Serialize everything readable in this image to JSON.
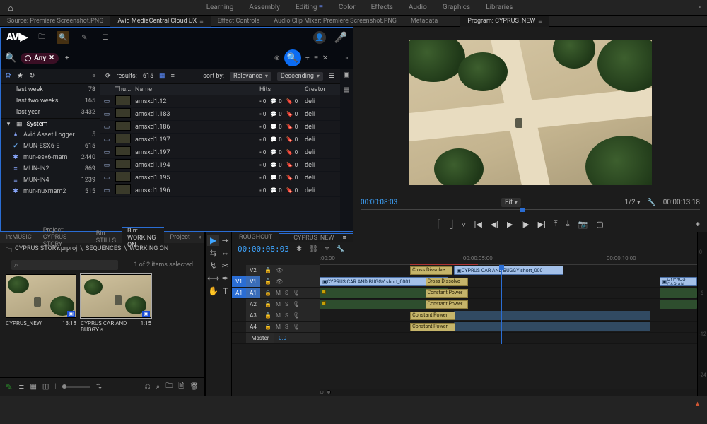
{
  "workspace": {
    "items": [
      "Learning",
      "Assembly",
      "Editing",
      "Color",
      "Effects",
      "Audio",
      "Graphics",
      "Libraries"
    ],
    "active": "Editing"
  },
  "source_tabs": {
    "items": [
      "Source: Premiere Screenshot.PNG",
      "Avid MediaCentral Cloud UX",
      "Effect Controls",
      "Audio Clip Mixer: Premiere Screenshot.PNG",
      "Metadata"
    ],
    "active": 1
  },
  "program_tab": "Program: CYPRUS_NEW",
  "avid": {
    "tag": {
      "label": "Any"
    },
    "results_label": "results:",
    "results_count": "615",
    "sort_label": "sort by:",
    "sort_field": "Relevance",
    "sort_dir": "Descending",
    "side_saved": [
      {
        "label": "last week",
        "count": "78"
      },
      {
        "label": "last two weeks",
        "count": "165"
      },
      {
        "label": "last year",
        "count": "3432"
      }
    ],
    "side_sys_label": "System",
    "side_sys": [
      {
        "ic": "★",
        "label": "Avid Asset Logger",
        "count": "5"
      },
      {
        "ic": "✔",
        "label": "MUN-ESX6-E",
        "count": "615"
      },
      {
        "ic": "✱",
        "label": "mun-esx6-mam",
        "count": "2440"
      },
      {
        "ic": "≡",
        "label": "MUN-IN2",
        "count": "869"
      },
      {
        "ic": "≡",
        "label": "MUN-IN4",
        "count": "1239"
      },
      {
        "ic": "✱",
        "label": "mun-nuxmam2",
        "count": "515"
      }
    ],
    "cols": {
      "thumb": "Thu...",
      "name": "Name",
      "hits": "Hits",
      "creator": "Creator"
    },
    "rows": [
      {
        "name": "amsxd1.12",
        "creator": "deli"
      },
      {
        "name": "amsxd1.183",
        "creator": "deli"
      },
      {
        "name": "amsxd1.186",
        "creator": "deli"
      },
      {
        "name": "amsxd1.197",
        "creator": "deli"
      },
      {
        "name": "amsxd1.197",
        "creator": "deli"
      },
      {
        "name": "amsxd1.194",
        "creator": "deli"
      },
      {
        "name": "amsxd1.195",
        "creator": "deli"
      },
      {
        "name": "amsxd1.196",
        "creator": "deli"
      }
    ],
    "hits_template": {
      "a": "0",
      "b": "0",
      "c": "0"
    }
  },
  "program": {
    "tc_in": "00:00:08:03",
    "fit": "Fit",
    "zoom": "1/2",
    "tc_out": "00:00:13:18"
  },
  "project": {
    "tabs": [
      "in:MUSIC",
      "Project: CYPRUS STORY",
      "Bin: STILLS",
      "Bin: WORKING ON",
      "Project"
    ],
    "active": 3,
    "crumb_parts": [
      "CYPRUS STORY.prproj",
      "SEQUENCES",
      "WORKING ON"
    ],
    "selected_text": "1 of 2 items selected",
    "clips": [
      {
        "name": "CYPRUS_NEW",
        "dur": "13:18"
      },
      {
        "name": "CYPRUS CAR AND BUGGY s...",
        "dur": "1:15"
      }
    ]
  },
  "timeline": {
    "tabs": [
      "ROUGHCUT",
      "CYPRUS_NEW"
    ],
    "active": 1,
    "tc": "00:00:08:03",
    "ruler": [
      {
        "t": ":00:00",
        "p": 0
      },
      {
        "t": "00:00:05:00",
        "p": 38
      },
      {
        "t": "00:00:10:00",
        "p": 76
      }
    ],
    "tracks": {
      "v2": {
        "label": "V2"
      },
      "v1": {
        "label": "V1",
        "target": "V1"
      },
      "a1": {
        "label": "A1",
        "target": "A1"
      },
      "a2": {
        "label": "A2"
      },
      "a3": {
        "label": "A3"
      },
      "a4": {
        "label": "A4"
      },
      "master": {
        "label": "Master",
        "val": "0.0"
      }
    },
    "clips": {
      "v2_clip": "CYPRUS CAR AND BUGGY short_0001",
      "v1_clip": "CYPRUS CAR AND BUGGY short_0001",
      "v1_clip2": "CYPRUS CAR AN",
      "cross": "Cross Dissolve",
      "cpow": "Constant Power"
    }
  }
}
